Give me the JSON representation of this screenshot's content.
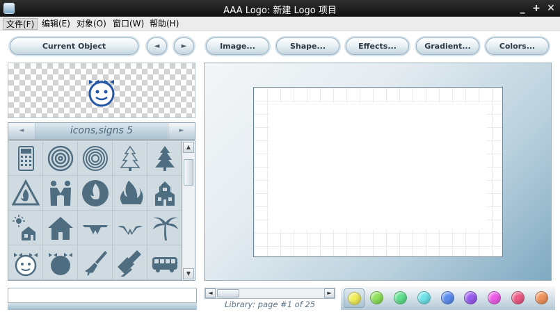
{
  "window": {
    "title": "AAA Logo: 新建 Logo 项目",
    "buttons": {
      "minimize": "_",
      "maximize": "+",
      "close": "✕"
    }
  },
  "menu": {
    "items": [
      {
        "label": "文件(F)"
      },
      {
        "label": "编辑(E)"
      },
      {
        "label": "对象(O)"
      },
      {
        "label": "窗口(W)"
      },
      {
        "label": "帮助(H)"
      }
    ]
  },
  "toolbar": {
    "current_object": "Current Object",
    "prev": "◄",
    "next": "►",
    "image": "Image...",
    "shape": "Shape...",
    "effects": "Effects...",
    "gradient": "Gradient...",
    "colors": "Colors..."
  },
  "library": {
    "category": "icons,signs 5",
    "prev": "◄",
    "next": "►",
    "page_label": "Library: page #1 of 25",
    "icons": [
      "calculator-icon",
      "spiral-icon",
      "double-spiral-icon",
      "christmas-tree-outline-icon",
      "christmas-tree-icon",
      "fire-warning-icon",
      "handshake-icon",
      "fire-circle-icon",
      "flames-icon",
      "schoolhouse-icon",
      "house-sun-icon",
      "house-icon",
      "winged-w-icon",
      "wing-w-icon",
      "palm-tree-icon",
      "girl-face-icon",
      "boy-face-icon",
      "paint-brush-icon",
      "stamp-icon",
      "bus-icon"
    ]
  },
  "colors": {
    "accent": "#8da3b1",
    "swatches": [
      "#f2ee5a",
      "#8fe05a",
      "#5fe08c",
      "#6de3ea",
      "#5c8ef0",
      "#9a5cf0",
      "#ee5ce8",
      "#ee5c86",
      "#f0935c"
    ]
  }
}
